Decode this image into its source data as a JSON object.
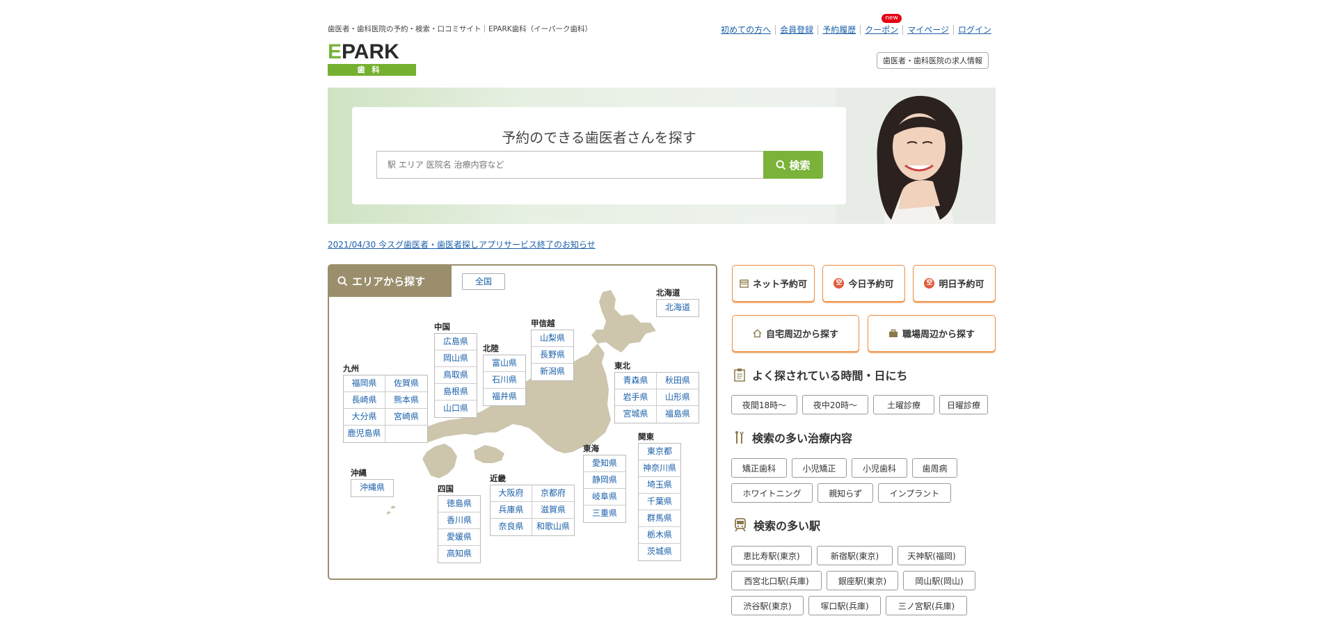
{
  "header": {
    "tagline": "歯医者・歯科医院の予約・検索・口コミサイト｜EPARK歯科（イーパーク歯科）",
    "logo_main": "PARK",
    "logo_e": "E",
    "logo_sub": "歯科",
    "nav": [
      "初めての方へ",
      "会員登録",
      "予約履歴",
      "クーポン",
      "マイページ",
      "ログイン"
    ],
    "new_badge": "new",
    "recruit": "歯医者・歯科医院の求人情報"
  },
  "search": {
    "title": "予約のできる歯医者さんを探す",
    "placeholder": "駅 エリア 医院名 治療内容など",
    "button": "検索"
  },
  "notice": "2021/04/30 今スグ歯医者・歯医者探しアプリサービス終了のお知らせ",
  "area": {
    "tab": "エリアから探す",
    "zenkoku": "全国",
    "regions": {
      "hokkaido": {
        "label": "北海道",
        "prefs": [
          "北海道"
        ]
      },
      "tohoku": {
        "label": "東北",
        "prefs": [
          "青森県",
          "秋田県",
          "岩手県",
          "山形県",
          "宮城県",
          "福島県"
        ]
      },
      "koshinetsu": {
        "label": "甲信越",
        "prefs": [
          "山梨県",
          "長野県",
          "新潟県"
        ]
      },
      "hokuriku": {
        "label": "北陸",
        "prefs": [
          "富山県",
          "石川県",
          "福井県"
        ]
      },
      "chugoku": {
        "label": "中国",
        "prefs": [
          "広島県",
          "岡山県",
          "鳥取県",
          "島根県",
          "山口県"
        ]
      },
      "kyushu": {
        "label": "九州",
        "prefs": [
          "福岡県",
          "佐賀県",
          "長崎県",
          "熊本県",
          "大分県",
          "宮崎県",
          "鹿児島県"
        ]
      },
      "okinawa": {
        "label": "沖縄",
        "prefs": [
          "沖縄県"
        ]
      },
      "shikoku": {
        "label": "四国",
        "prefs": [
          "徳島県",
          "香川県",
          "愛媛県",
          "高知県"
        ]
      },
      "kinki": {
        "label": "近畿",
        "prefs": [
          "大阪府",
          "京都府",
          "兵庫県",
          "滋賀県",
          "奈良県",
          "和歌山県"
        ]
      },
      "tokai": {
        "label": "東海",
        "prefs": [
          "愛知県",
          "静岡県",
          "岐阜県",
          "三重県"
        ]
      },
      "kanto": {
        "label": "関東",
        "prefs": [
          "東京都",
          "神奈川県",
          "埼玉県",
          "千葉県",
          "群馬県",
          "栃木県",
          "茨城県"
        ]
      }
    }
  },
  "quick": {
    "net": "ネット予約可",
    "today": "今日予約可",
    "tomorrow": "明日予約可",
    "today_icon": "空",
    "tomorrow_icon": "空",
    "home": "自宅周辺から探す",
    "work": "職場周辺から探す"
  },
  "popular_time": {
    "title": "よく探されている時間・日にち",
    "tags": [
      "夜間18時〜",
      "夜中20時〜",
      "土曜診療",
      "日曜診療"
    ]
  },
  "popular_treatment": {
    "title": "検索の多い治療内容",
    "tags": [
      "矯正歯科",
      "小児矯正",
      "小児歯科",
      "歯周病",
      "ホワイトニング",
      "親知らず",
      "インプラント"
    ]
  },
  "popular_station": {
    "title": "検索の多い駅",
    "tags": [
      "恵比寿駅(東京)",
      "新宿駅(東京)",
      "天神駅(福岡)",
      "西宮北口駅(兵庫)",
      "銀座駅(東京)",
      "岡山駅(岡山)",
      "渋谷駅(東京)",
      "塚口駅(兵庫)",
      "三ノ宮駅(兵庫)"
    ]
  },
  "colors": {
    "brand_green": "#7ab23a",
    "area_brown": "#9a8e6c",
    "accent_orange": "#ef8a3c",
    "link_blue": "#1a5fa8"
  }
}
